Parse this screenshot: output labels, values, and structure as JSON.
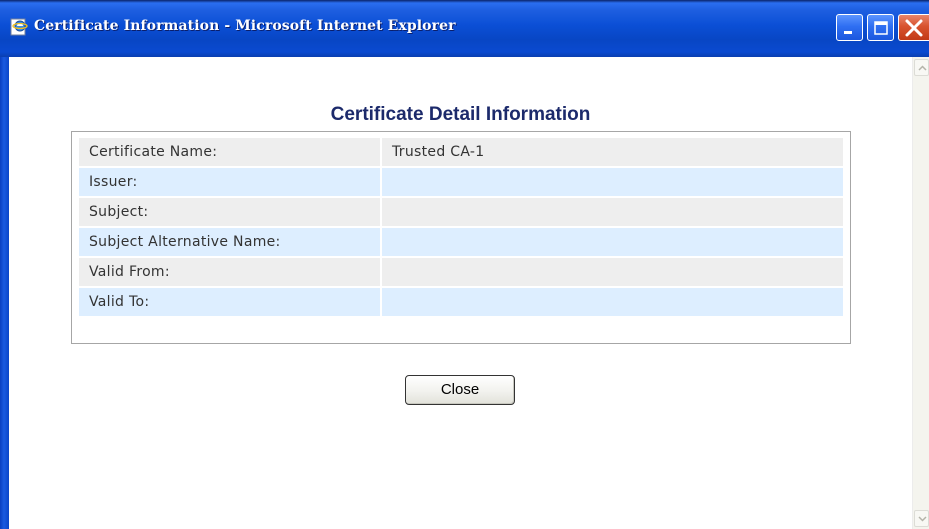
{
  "window": {
    "title": "Certificate Information - Microsoft Internet Explorer",
    "buttons": [
      "minimize",
      "maximize",
      "close"
    ]
  },
  "page": {
    "heading": "Certificate Detail Information",
    "fields": [
      {
        "label": "Certificate Name:",
        "value": "Trusted CA-1"
      },
      {
        "label": "Issuer:",
        "value": ""
      },
      {
        "label": "Subject:",
        "value": ""
      },
      {
        "label": "Subject Alternative Name:",
        "value": ""
      },
      {
        "label": "Valid From:",
        "value": ""
      },
      {
        "label": "Valid To:",
        "value": ""
      }
    ],
    "close_label": "Close"
  },
  "colors": {
    "heading": "#1c2a6b",
    "row_even": "#eeeeee",
    "row_odd": "#ddeeff",
    "titlebar": "#0b4fd6"
  },
  "icons": {
    "app": "ie-page-icon",
    "scroll_up": "chevron-up-icon",
    "scroll_down": "chevron-down-icon"
  }
}
